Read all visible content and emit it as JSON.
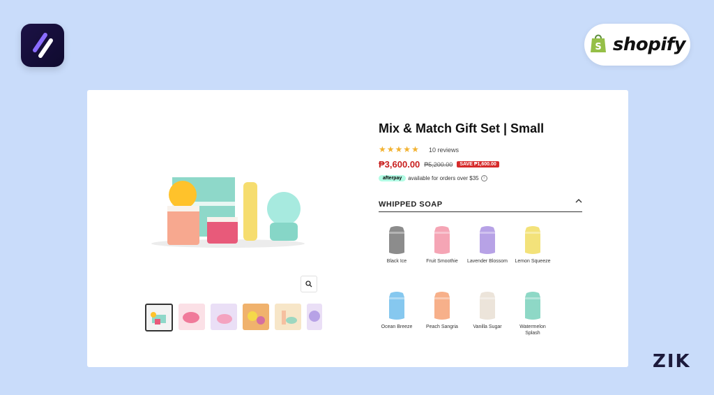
{
  "brand": {
    "shopify_label": "shopify",
    "footer_logo": "ZIK",
    "app_icon": "app-logo-icon",
    "shopify_icon": "shopify-bag-icon"
  },
  "product": {
    "title": "Mix & Match Gift Set | Small",
    "rating": 5,
    "reviews": "10 reviews",
    "price": "₱3,600.00",
    "compare_price": "₱5,200.00",
    "save_badge": "SAVE ₱1,600.00",
    "afterpay_badge": "afterpay",
    "afterpay_text": "available for orders over $35",
    "info_icon": "ⓘ"
  },
  "accordion": {
    "title": "WHIPPED SOAP",
    "expanded": true
  },
  "swatches": [
    {
      "label": "Black Ice",
      "color": "#8c8c8c"
    },
    {
      "label": "Fruit Smoothie",
      "color": "#f5a5b5"
    },
    {
      "label": "Lavender Blossom",
      "color": "#b7a2e6"
    },
    {
      "label": "Lemon Squeeze",
      "color": "#f3e27a"
    },
    {
      "label": "Ocean Breeze",
      "color": "#86c8ef"
    },
    {
      "label": "Peach Sangria",
      "color": "#f7b08a"
    },
    {
      "label": "Vanilla Sugar",
      "color": "#ece4da"
    },
    {
      "label": "Watermelon Splash",
      "color": "#8ed8c6"
    }
  ],
  "colors": {
    "background": "#c9dcfa",
    "price_red": "#c8201f",
    "star": "#f2b230"
  }
}
